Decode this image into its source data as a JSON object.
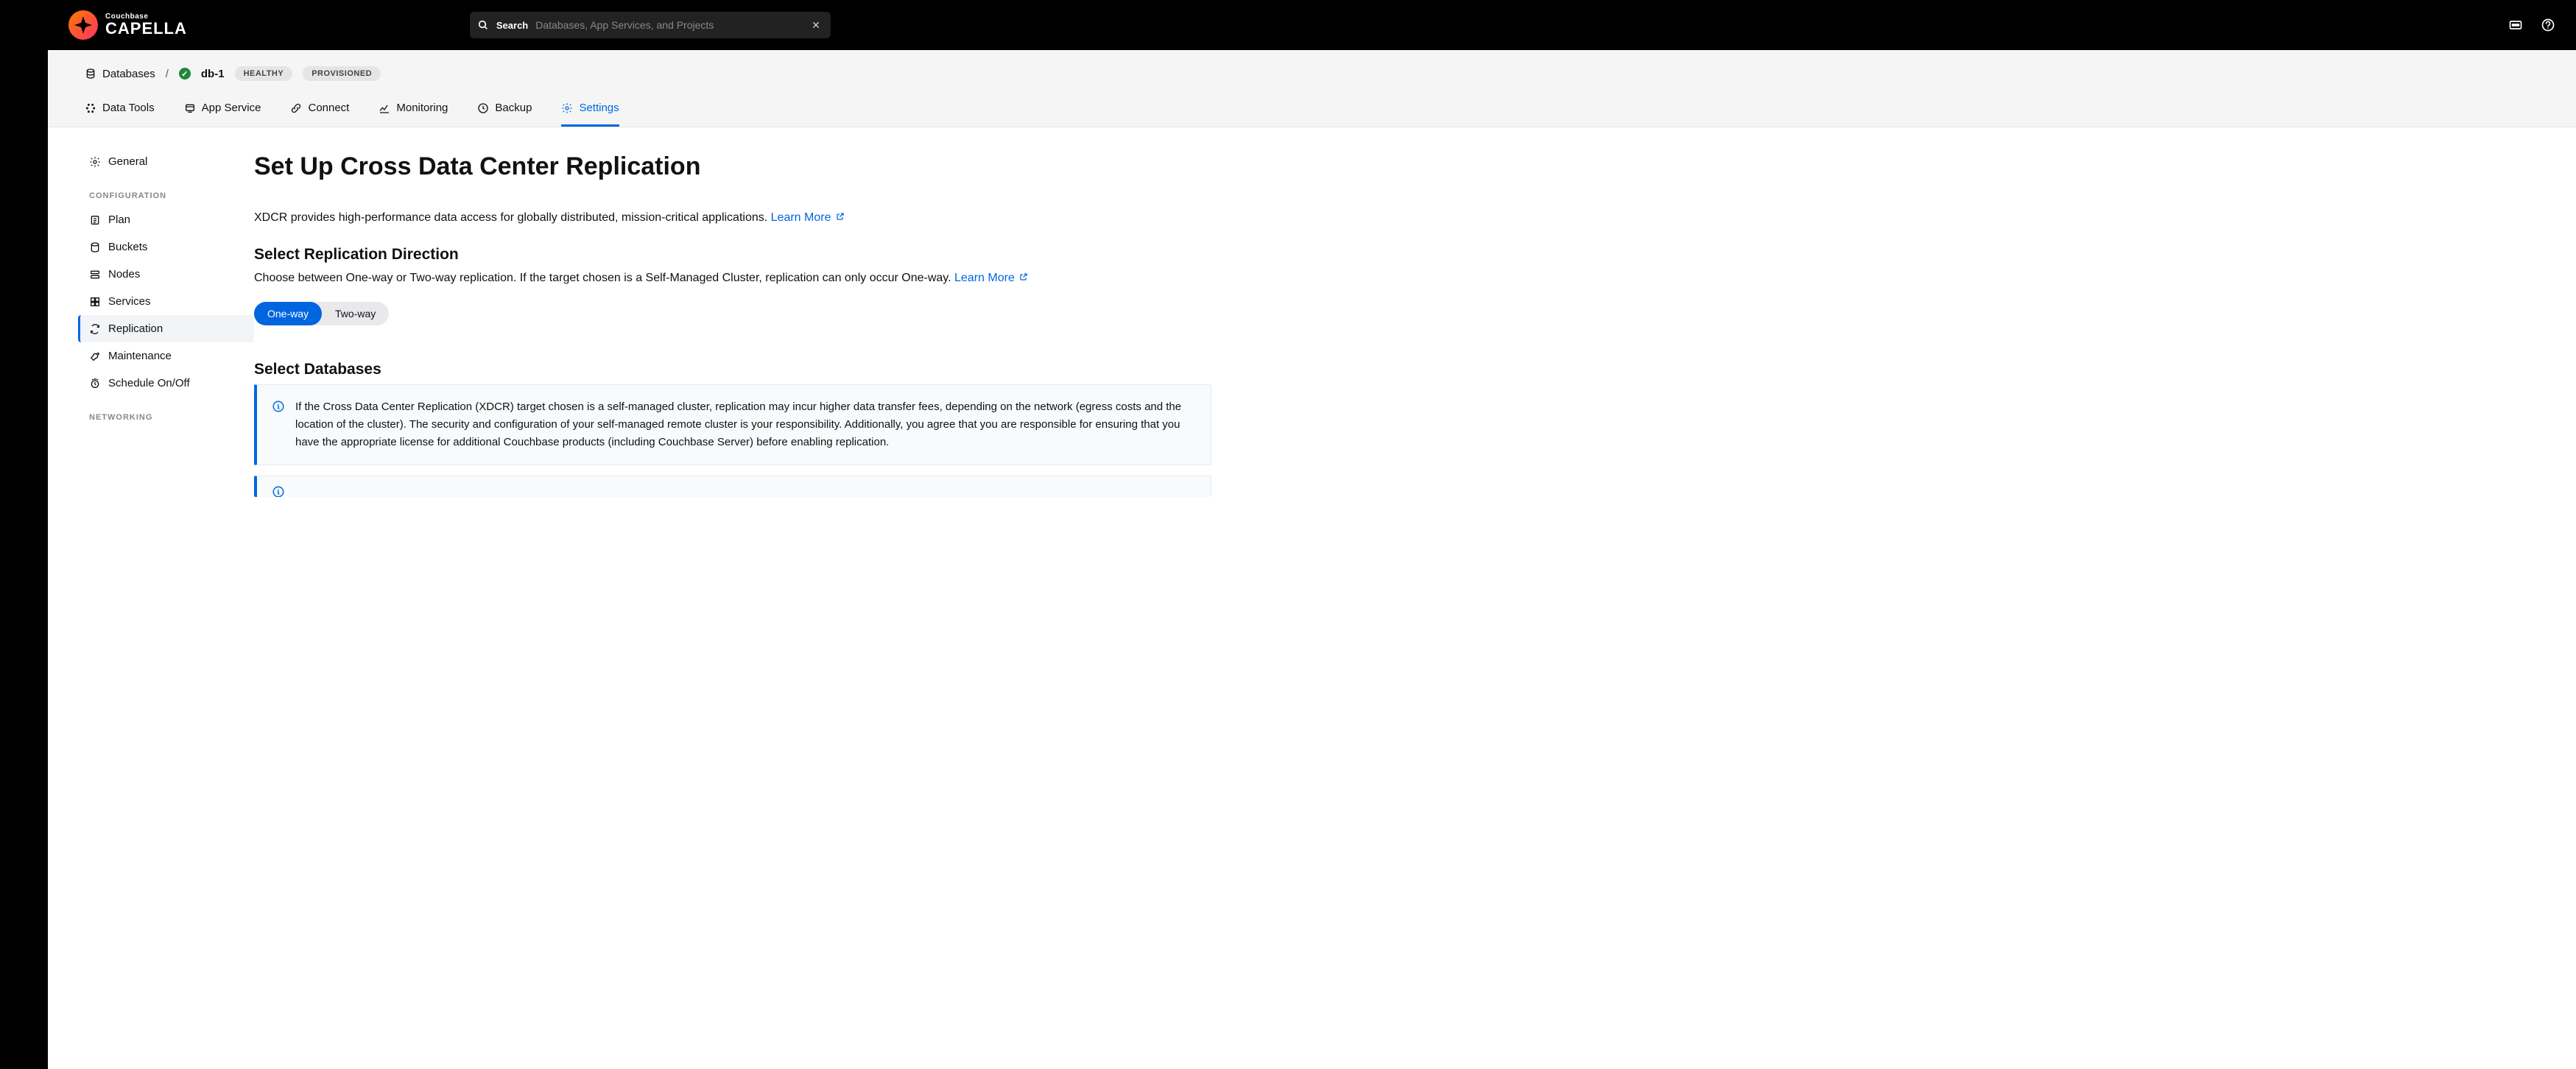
{
  "brand": {
    "sub": "Couchbase",
    "main": "CAPELLA"
  },
  "search": {
    "label": "Search",
    "placeholder": "Databases, App Services, and Projects"
  },
  "breadcrumb": {
    "root": "Databases",
    "db_name": "db-1",
    "health": "HEALTHY",
    "provision": "PROVISIONED"
  },
  "tabs": [
    {
      "id": "data-tools",
      "label": "Data Tools"
    },
    {
      "id": "app-service",
      "label": "App Service"
    },
    {
      "id": "connect",
      "label": "Connect"
    },
    {
      "id": "monitoring",
      "label": "Monitoring"
    },
    {
      "id": "backup",
      "label": "Backup"
    },
    {
      "id": "settings",
      "label": "Settings"
    }
  ],
  "sidebar": {
    "general": "General",
    "section_config": "CONFIGURATION",
    "config_items": [
      {
        "id": "plan",
        "label": "Plan"
      },
      {
        "id": "buckets",
        "label": "Buckets"
      },
      {
        "id": "nodes",
        "label": "Nodes"
      },
      {
        "id": "services",
        "label": "Services"
      },
      {
        "id": "replication",
        "label": "Replication"
      },
      {
        "id": "maintenance",
        "label": "Maintenance"
      },
      {
        "id": "schedule",
        "label": "Schedule On/Off"
      }
    ],
    "section_networking": "NETWORKING"
  },
  "page": {
    "title": "Set Up Cross Data Center Replication",
    "intro": "XDCR provides high-performance data access for globally distributed, mission-critical applications. ",
    "learn_more": "Learn More",
    "direction_heading": "Select Replication Direction",
    "direction_sub": "Choose between One-way or Two-way replication. If the target chosen is a Self-Managed Cluster, replication can only occur One-way. ",
    "toggle": {
      "one": "One-way",
      "two": "Two-way"
    },
    "databases_heading": "Select Databases",
    "info1": "If the Cross Data Center Replication (XDCR) target chosen is a self-managed cluster, replication may incur higher data transfer fees, depending on the network (egress costs and the location of the cluster). The security and configuration of your self-managed remote cluster is your responsibility. Additionally, you agree that you are responsible for ensuring that you have the appropriate license for additional Couchbase products (including Couchbase Server) before enabling replication."
  }
}
